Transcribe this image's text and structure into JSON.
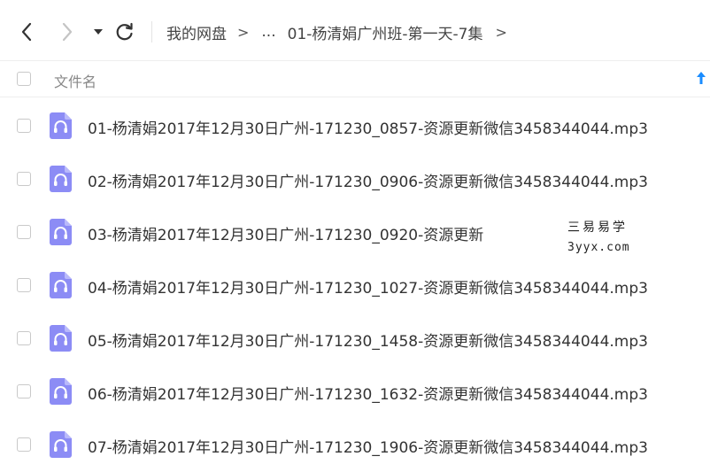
{
  "breadcrumb": {
    "root": "我的网盘",
    "ellipsis": "...",
    "current": "01-杨清娟广州班-第一天-7集",
    "separator": ">"
  },
  "table": {
    "column_name": "文件名"
  },
  "files": [
    {
      "name": "01-杨清娟2017年12月30日广州-171230_0857-资源更新微信3458344044.mp3"
    },
    {
      "name": "02-杨清娟2017年12月30日广州-171230_0906-资源更新微信3458344044.mp3"
    },
    {
      "name": "03-杨清娟2017年12月30日广州-171230_0920-资源更新"
    },
    {
      "name": "04-杨清娟2017年12月30日广州-171230_1027-资源更新微信3458344044.mp3"
    },
    {
      "name": "05-杨清娟2017年12月30日广州-171230_1458-资源更新微信3458344044.mp3"
    },
    {
      "name": "06-杨清娟2017年12月30日广州-171230_1632-资源更新微信3458344044.mp3"
    },
    {
      "name": "07-杨清娟2017年12月30日广州-171230_1906-资源更新微信3458344044.mp3"
    }
  ],
  "watermark": {
    "line1": "三易易学",
    "line2": "3yyx.com"
  },
  "icons": {
    "file": "audio-file-icon",
    "back": "back-arrow-icon",
    "forward": "forward-arrow-icon",
    "history": "dropdown-caret-icon",
    "refresh": "refresh-icon",
    "sort": "sort-ascending-icon"
  },
  "colors": {
    "file_icon": "#8c8cf5",
    "sort_arrow": "#1a8cff"
  }
}
